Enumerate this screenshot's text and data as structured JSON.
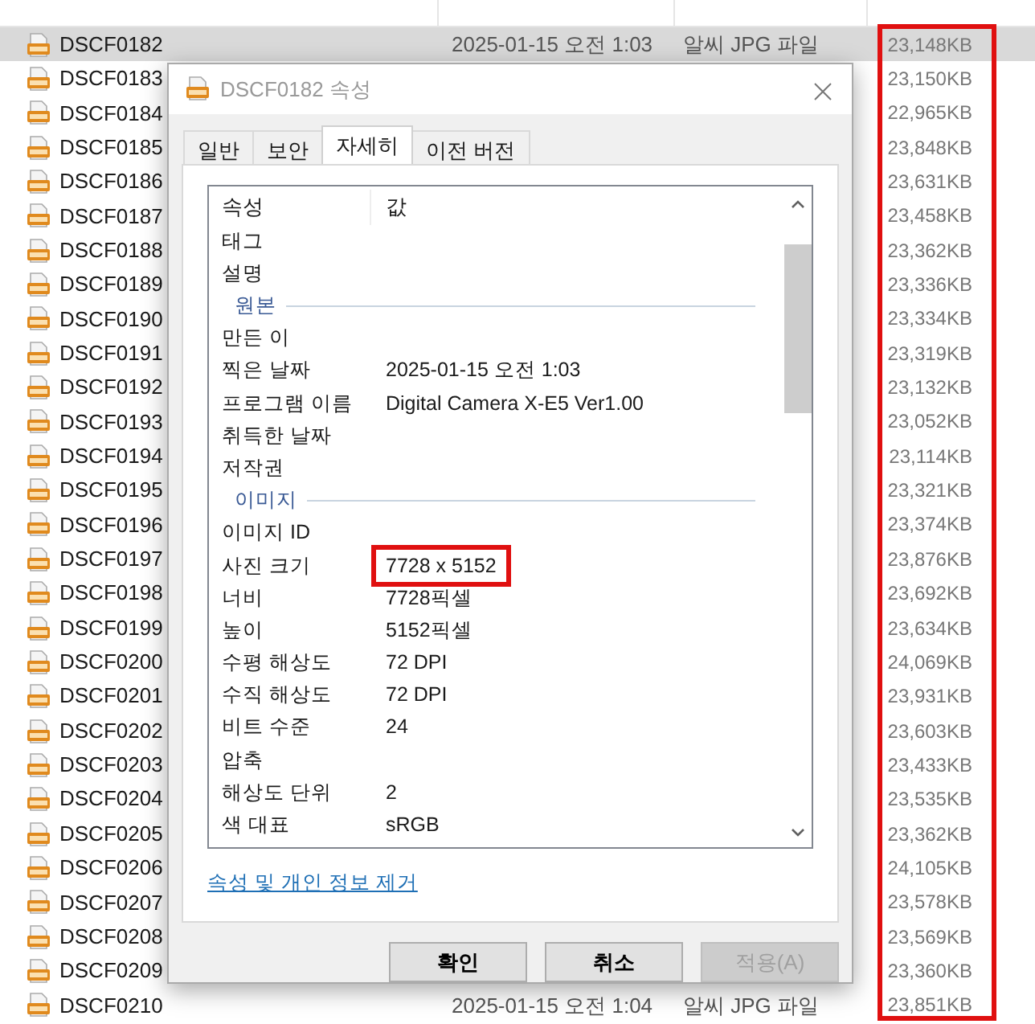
{
  "file_list": {
    "size_column_highlighted": true,
    "rows": [
      {
        "name": "DSCF0182",
        "selected": true,
        "modified": "2025-01-15 오전 1:03",
        "type": "알씨 JPG 파일",
        "size": "23,148KB"
      },
      {
        "name": "DSCF0183",
        "selected": false,
        "size": "23,150KB"
      },
      {
        "name": "DSCF0184",
        "selected": false,
        "size": "22,965KB"
      },
      {
        "name": "DSCF0185",
        "selected": false,
        "size": "23,848KB"
      },
      {
        "name": "DSCF0186",
        "selected": false,
        "size": "23,631KB"
      },
      {
        "name": "DSCF0187",
        "selected": false,
        "size": "23,458KB"
      },
      {
        "name": "DSCF0188",
        "selected": false,
        "size": "23,362KB"
      },
      {
        "name": "DSCF0189",
        "selected": false,
        "size": "23,336KB"
      },
      {
        "name": "DSCF0190",
        "selected": false,
        "size": "23,334KB"
      },
      {
        "name": "DSCF0191",
        "selected": false,
        "size": "23,319KB"
      },
      {
        "name": "DSCF0192",
        "selected": false,
        "size": "23,132KB"
      },
      {
        "name": "DSCF0193",
        "selected": false,
        "size": "23,052KB"
      },
      {
        "name": "DSCF0194",
        "selected": false,
        "size": "23,114KB"
      },
      {
        "name": "DSCF0195",
        "selected": false,
        "size": "23,321KB"
      },
      {
        "name": "DSCF0196",
        "selected": false,
        "size": "23,374KB"
      },
      {
        "name": "DSCF0197",
        "selected": false,
        "size": "23,876KB"
      },
      {
        "name": "DSCF0198",
        "selected": false,
        "size": "23,692KB"
      },
      {
        "name": "DSCF0199",
        "selected": false,
        "size": "23,634KB"
      },
      {
        "name": "DSCF0200",
        "selected": false,
        "size": "24,069KB"
      },
      {
        "name": "DSCF0201",
        "selected": false,
        "size": "23,931KB"
      },
      {
        "name": "DSCF0202",
        "selected": false,
        "size": "23,603KB"
      },
      {
        "name": "DSCF0203",
        "selected": false,
        "size": "23,433KB"
      },
      {
        "name": "DSCF0204",
        "selected": false,
        "size": "23,535KB"
      },
      {
        "name": "DSCF0205",
        "selected": false,
        "size": "23,362KB"
      },
      {
        "name": "DSCF0206",
        "selected": false,
        "size": "24,105KB"
      },
      {
        "name": "DSCF0207",
        "selected": false,
        "size": "23,578KB"
      },
      {
        "name": "DSCF0208",
        "selected": false,
        "size": "23,569KB"
      },
      {
        "name": "DSCF0209",
        "selected": false,
        "size": "23,360KB"
      },
      {
        "name": "DSCF0210",
        "selected": false,
        "modified": "2025-01-15 오전 1:04",
        "type": "알씨 JPG 파일",
        "size": "23,851KB"
      }
    ]
  },
  "dialog": {
    "title": "DSCF0182 속성",
    "tabs": [
      {
        "label": "일반",
        "selected": false
      },
      {
        "label": "보안",
        "selected": false
      },
      {
        "label": "자세히",
        "selected": true
      },
      {
        "label": "이전 버전",
        "selected": false
      }
    ],
    "columns": [
      "속성",
      "값"
    ],
    "properties": [
      {
        "kind": "row",
        "name": "태그"
      },
      {
        "kind": "row",
        "name": "설명"
      },
      {
        "kind": "section",
        "name": "원본"
      },
      {
        "kind": "row",
        "name": "만든 이"
      },
      {
        "kind": "row",
        "name": "찍은 날짜",
        "value": "2025-01-15 오전 1:03"
      },
      {
        "kind": "row",
        "name": "프로그램 이름",
        "value": "Digital Camera X-E5 Ver1.00"
      },
      {
        "kind": "row",
        "name": "취득한 날짜"
      },
      {
        "kind": "row",
        "name": "저작권"
      },
      {
        "kind": "section",
        "name": "이미지"
      },
      {
        "kind": "row",
        "name": "이미지 ID"
      },
      {
        "kind": "row",
        "name": "사진 크기",
        "value": "7728 x 5152",
        "highlighted": true
      },
      {
        "kind": "row",
        "name": "너비",
        "value": "7728픽셀"
      },
      {
        "kind": "row",
        "name": "높이",
        "value": "5152픽셀"
      },
      {
        "kind": "row",
        "name": "수평 해상도",
        "value": "72 DPI"
      },
      {
        "kind": "row",
        "name": "수직 해상도",
        "value": "72 DPI"
      },
      {
        "kind": "row",
        "name": "비트 수준",
        "value": "24"
      },
      {
        "kind": "row",
        "name": "압축"
      },
      {
        "kind": "row",
        "name": "해상도 단위",
        "value": "2"
      },
      {
        "kind": "row",
        "name": "색 대표",
        "value": "sRGB"
      }
    ],
    "link": "속성 및 개인 정보 제거",
    "buttons": [
      {
        "label": "확인",
        "disabled": false
      },
      {
        "label": "취소",
        "disabled": false
      },
      {
        "label": "적용(A)",
        "disabled": true
      }
    ]
  }
}
